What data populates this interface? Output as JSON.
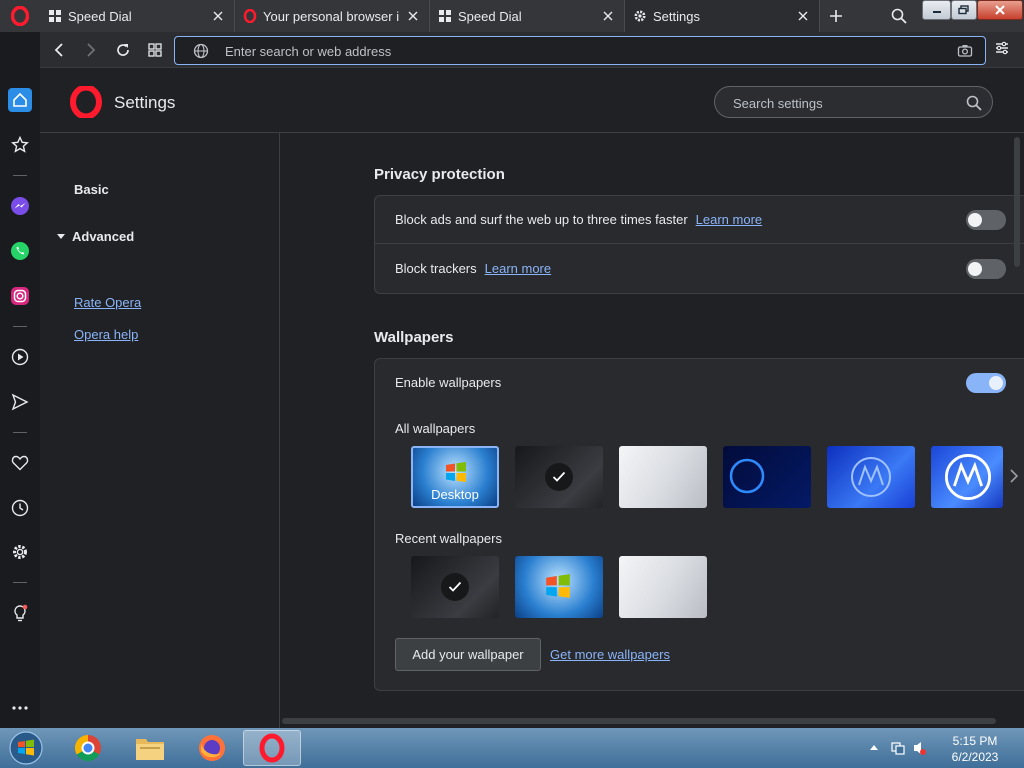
{
  "tabs": [
    {
      "label": "Speed Dial",
      "icon": "speed-dial-icon",
      "active": false
    },
    {
      "label": "Your personal browser is a",
      "icon": "opera-icon",
      "active": false
    },
    {
      "label": "Speed Dial",
      "icon": "speed-dial-icon",
      "active": false
    },
    {
      "label": "Settings",
      "icon": "gear-icon",
      "active": true
    }
  ],
  "addressbar": {
    "placeholder": "Enter search or web address"
  },
  "header": {
    "title": "Settings",
    "search_placeholder": "Search settings"
  },
  "nav": {
    "basic": "Basic",
    "advanced": "Advanced",
    "rate": "Rate Opera",
    "help": "Opera help"
  },
  "privacy": {
    "title": "Privacy protection",
    "block_ads": "Block ads and surf the web up to three times faster",
    "block_trackers": "Block trackers",
    "learn_more": "Learn more",
    "block_ads_on": false,
    "block_trackers_on": false
  },
  "wallpapers": {
    "title": "Wallpapers",
    "enable": "Enable wallpapers",
    "enabled": true,
    "all": "All wallpapers",
    "recent": "Recent wallpapers",
    "desktop_label": "Desktop",
    "add_button": "Add your wallpaper",
    "get_more": "Get more wallpapers"
  },
  "clock": {
    "time": "5:15 PM",
    "date": "6/2/2023"
  },
  "colors": {
    "accent": "#8ab4f8",
    "background": "#202124",
    "card": "#292a2d"
  }
}
